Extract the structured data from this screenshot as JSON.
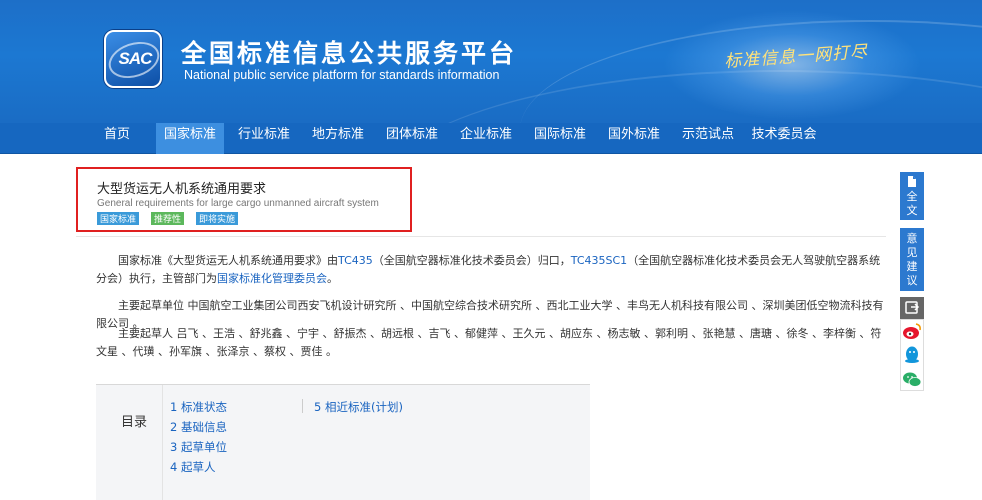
{
  "header": {
    "logo_text": "SAC",
    "title": "全国标准信息公共服务平台",
    "subtitle": "National public service platform  for standards information",
    "slogan": "标准信息一网打尽"
  },
  "nav": {
    "items": [
      "首页",
      "国家标准",
      "行业标准",
      "地方标准",
      "团体标准",
      "企业标准",
      "国际标准",
      "国外标准",
      "示范试点",
      "技术委员会"
    ],
    "active_index": 1
  },
  "standard": {
    "title_cn": "大型货运无人机系统通用要求",
    "title_en": "General requirements for large cargo unmanned aircraft system",
    "badges": [
      "国家标准",
      "推荐性",
      "即将实施"
    ]
  },
  "description": {
    "p1_a": "国家标准《大型货运无人机系统通用要求》由",
    "p1_tc": "TC435",
    "p1_b": "（全国航空器标准化技术委员会）归口，",
    "p1_sc": "TC435SC1",
    "p1_c": "（全国航空器标准化技术委员会无人驾驶航空器系统分会）执行，主管部门为",
    "p1_dept": "国家标准化管理委员会",
    "p1_d": "。",
    "p2": "主要起草单位 中国航空工业集团公司西安飞机设计研究所 、中国航空综合技术研究所 、西北工业大学 、丰鸟无人机科技有限公司 、深圳美团低空物流科技有限公司 。",
    "p3": "主要起草人 吕飞 、王浩 、舒兆鑫 、宁宇 、舒振杰 、胡远根 、吉飞 、郁健萍 、王久元 、胡应东 、杨志敏 、郭利明 、张艳慧 、唐瑭 、徐冬 、李梓衡 、符文星 、代璜 、孙军旗 、张泽京 、蔡权 、贾佳 。"
  },
  "toc": {
    "label": "目录",
    "items": [
      "1  标准状态",
      "2  基础信息",
      "3  起草单位",
      "4  起草人",
      "5  相近标准(计划)"
    ]
  },
  "sidebar": {
    "full_text": [
      "全",
      "文"
    ],
    "feedback": [
      "意",
      "见",
      "建",
      "议"
    ]
  },
  "colors": {
    "banner": "#1c78d2",
    "nav": "#1667c0",
    "nav_active": "#3d8fe0",
    "link": "#1a64c0",
    "highlight_box": "#e02020"
  }
}
